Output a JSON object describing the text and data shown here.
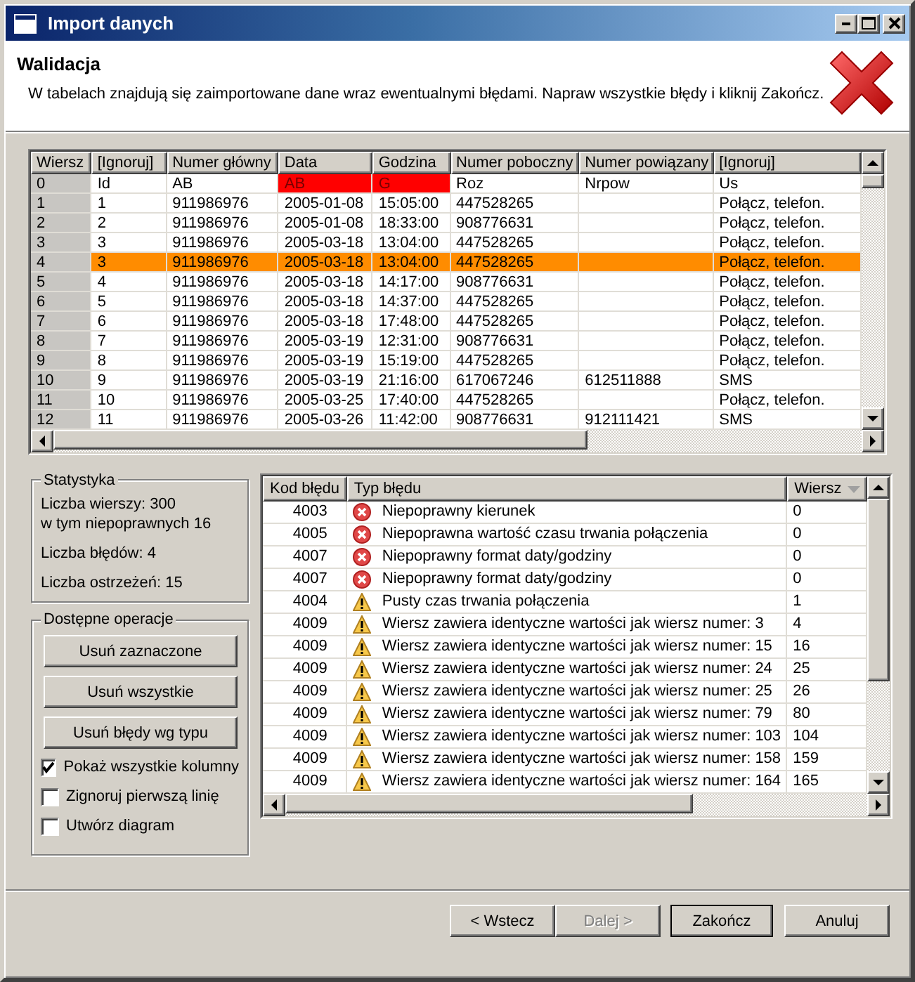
{
  "window": {
    "title": "Import danych"
  },
  "header": {
    "title": "Walidacja",
    "description": "W tabelach znajdują się zaimportowane dane wraz ewentualnymi błędami. Napraw wszystkie błędy i kliknij Zakończ."
  },
  "data_table": {
    "columns": [
      "Wiersz",
      "[Ignoruj]",
      "Numer główny",
      "Data",
      "Godzina",
      "Numer poboczny",
      "Numer powiązany",
      "[Ignoruj]"
    ],
    "rows": [
      {
        "selected": false,
        "cells": [
          {
            "text": "0",
            "error": false
          },
          {
            "text": "Id",
            "error": false
          },
          {
            "text": "AB",
            "error": false
          },
          {
            "text": "AB",
            "error": true
          },
          {
            "text": "G",
            "error": true
          },
          {
            "text": "Roz",
            "error": false
          },
          {
            "text": "Nrpow",
            "error": false
          },
          {
            "text": "Us",
            "error": false
          }
        ]
      },
      {
        "selected": false,
        "cells": [
          {
            "text": "1",
            "error": false
          },
          {
            "text": "1",
            "error": false
          },
          {
            "text": "911986976",
            "error": false
          },
          {
            "text": "2005-01-08",
            "error": false
          },
          {
            "text": "15:05:00",
            "error": false
          },
          {
            "text": "447528265",
            "error": false
          },
          {
            "error": false
          },
          {
            "text": "Połącz, telefon.",
            "error": false
          }
        ]
      },
      {
        "selected": false,
        "cells": [
          {
            "text": "2",
            "error": false
          },
          {
            "text": "2",
            "error": false
          },
          {
            "text": "911986976",
            "error": false
          },
          {
            "text": "2005-01-08",
            "error": false
          },
          {
            "text": "18:33:00",
            "error": false
          },
          {
            "text": "908776631",
            "error": false
          },
          {
            "error": false
          },
          {
            "text": "Połącz, telefon.",
            "error": false
          }
        ]
      },
      {
        "selected": false,
        "cells": [
          {
            "text": "3",
            "error": false
          },
          {
            "text": "3",
            "error": false
          },
          {
            "text": "911986976",
            "error": false
          },
          {
            "text": "2005-03-18",
            "error": false
          },
          {
            "text": "13:04:00",
            "error": false
          },
          {
            "text": "447528265",
            "error": false
          },
          {
            "error": false
          },
          {
            "text": "Połącz, telefon.",
            "error": false
          }
        ]
      },
      {
        "selected": true,
        "cells": [
          {
            "text": "4",
            "error": false
          },
          {
            "text": "3",
            "error": false
          },
          {
            "text": "911986976",
            "error": false
          },
          {
            "text": "2005-03-18",
            "error": false
          },
          {
            "text": "13:04:00",
            "error": false
          },
          {
            "text": "447528265",
            "error": false
          },
          {
            "error": false
          },
          {
            "text": "Połącz, telefon.",
            "error": false
          }
        ]
      },
      {
        "selected": false,
        "cells": [
          {
            "text": "5",
            "error": false
          },
          {
            "text": "4",
            "error": false
          },
          {
            "text": "911986976",
            "error": false
          },
          {
            "text": "2005-03-18",
            "error": false
          },
          {
            "text": "14:17:00",
            "error": false
          },
          {
            "text": "908776631",
            "error": false
          },
          {
            "error": false
          },
          {
            "text": "Połącz, telefon.",
            "error": false
          }
        ]
      },
      {
        "selected": false,
        "cells": [
          {
            "text": "6",
            "error": false
          },
          {
            "text": "5",
            "error": false
          },
          {
            "text": "911986976",
            "error": false
          },
          {
            "text": "2005-03-18",
            "error": false
          },
          {
            "text": "14:37:00",
            "error": false
          },
          {
            "text": "447528265",
            "error": false
          },
          {
            "error": false
          },
          {
            "text": "Połącz, telefon.",
            "error": false
          }
        ]
      },
      {
        "selected": false,
        "cells": [
          {
            "text": "7",
            "error": false
          },
          {
            "text": "6",
            "error": false
          },
          {
            "text": "911986976",
            "error": false
          },
          {
            "text": "2005-03-18",
            "error": false
          },
          {
            "text": "17:48:00",
            "error": false
          },
          {
            "text": "447528265",
            "error": false
          },
          {
            "error": false
          },
          {
            "text": "Połącz, telefon.",
            "error": false
          }
        ]
      },
      {
        "selected": false,
        "cells": [
          {
            "text": "8",
            "error": false
          },
          {
            "text": "7",
            "error": false
          },
          {
            "text": "911986976",
            "error": false
          },
          {
            "text": "2005-03-19",
            "error": false
          },
          {
            "text": "12:31:00",
            "error": false
          },
          {
            "text": "908776631",
            "error": false
          },
          {
            "error": false
          },
          {
            "text": "Połącz, telefon.",
            "error": false
          }
        ]
      },
      {
        "selected": false,
        "cells": [
          {
            "text": "9",
            "error": false
          },
          {
            "text": "8",
            "error": false
          },
          {
            "text": "911986976",
            "error": false
          },
          {
            "text": "2005-03-19",
            "error": false
          },
          {
            "text": "15:19:00",
            "error": false
          },
          {
            "text": "447528265",
            "error": false
          },
          {
            "error": false
          },
          {
            "text": "Połącz, telefon.",
            "error": false
          }
        ]
      },
      {
        "selected": false,
        "cells": [
          {
            "text": "10",
            "error": false
          },
          {
            "text": "9",
            "error": false
          },
          {
            "text": "911986976",
            "error": false
          },
          {
            "text": "2005-03-19",
            "error": false
          },
          {
            "text": "21:16:00",
            "error": false
          },
          {
            "text": "617067246",
            "error": false
          },
          {
            "text": "612511888",
            "error": false
          },
          {
            "text": "SMS",
            "error": false
          }
        ]
      },
      {
        "selected": false,
        "cells": [
          {
            "text": "11",
            "error": false
          },
          {
            "text": "10",
            "error": false
          },
          {
            "text": "911986976",
            "error": false
          },
          {
            "text": "2005-03-25",
            "error": false
          },
          {
            "text": "17:40:00",
            "error": false
          },
          {
            "text": "447528265",
            "error": false
          },
          {
            "error": false
          },
          {
            "text": "Połącz, telefon.",
            "error": false
          }
        ]
      },
      {
        "selected": false,
        "cells": [
          {
            "text": "12",
            "error": false
          },
          {
            "text": "11",
            "error": false
          },
          {
            "text": "911986976",
            "error": false
          },
          {
            "text": "2005-03-26",
            "error": false
          },
          {
            "text": "11:42:00",
            "error": false
          },
          {
            "text": "908776631",
            "error": false
          },
          {
            "text": "912111421",
            "error": false
          },
          {
            "text": "SMS",
            "error": false
          }
        ]
      }
    ]
  },
  "statistics": {
    "title": "Statystyka",
    "lines": [
      "Liczba wierszy: 300",
      "w tym niepoprawnych 16",
      "Liczba błędów: 4",
      "Liczba ostrzeżeń: 15"
    ]
  },
  "operations": {
    "title": "Dostępne operacje",
    "buttons": [
      "Usuń zaznaczone",
      "Usuń wszystkie",
      "Usuń błędy wg typu"
    ],
    "options": [
      {
        "label": "Pokaż wszystkie kolumny",
        "checked": true
      },
      {
        "label": "Zignoruj pierwszą linię",
        "checked": false
      },
      {
        "label": "Utwórz diagram",
        "checked": false
      }
    ]
  },
  "error_table": {
    "columns": [
      "Kod błędu",
      "Typ błędu",
      "Wiersz"
    ],
    "rows": [
      {
        "code": "4003",
        "kind": "error",
        "message": "Niepoprawny kierunek",
        "row": "0"
      },
      {
        "code": "4005",
        "kind": "error",
        "message": "Niepoprawna wartość czasu trwania połączenia",
        "row": "0"
      },
      {
        "code": "4007",
        "kind": "error",
        "message": "Niepoprawny format daty/godziny",
        "row": "0"
      },
      {
        "code": "4007",
        "kind": "error",
        "message": "Niepoprawny format daty/godziny",
        "row": "0"
      },
      {
        "code": "4004",
        "kind": "warning",
        "message": "Pusty czas trwania połączenia",
        "row": "1"
      },
      {
        "code": "4009",
        "kind": "warning",
        "message": "Wiersz zawiera identyczne wartości jak wiersz numer: 3",
        "row": "4"
      },
      {
        "code": "4009",
        "kind": "warning",
        "message": "Wiersz zawiera identyczne wartości jak wiersz numer: 15",
        "row": "16"
      },
      {
        "code": "4009",
        "kind": "warning",
        "message": "Wiersz zawiera identyczne wartości jak wiersz numer: 24",
        "row": "25"
      },
      {
        "code": "4009",
        "kind": "warning",
        "message": "Wiersz zawiera identyczne wartości jak wiersz numer: 25",
        "row": "26"
      },
      {
        "code": "4009",
        "kind": "warning",
        "message": "Wiersz zawiera identyczne wartości jak wiersz numer: 79",
        "row": "80"
      },
      {
        "code": "4009",
        "kind": "warning",
        "message": "Wiersz zawiera identyczne wartości jak wiersz numer: 103",
        "row": "104"
      },
      {
        "code": "4009",
        "kind": "warning",
        "message": "Wiersz zawiera identyczne wartości jak wiersz numer: 158",
        "row": "159"
      },
      {
        "code": "4009",
        "kind": "warning",
        "message": "Wiersz zawiera identyczne wartości jak wiersz numer: 164",
        "row": "165"
      }
    ]
  },
  "wizard_buttons": [
    {
      "label": "< Wstecz",
      "disabled": false,
      "default": false
    },
    {
      "label": "Dalej >",
      "disabled": true,
      "default": false
    },
    {
      "label": "Zakończ",
      "disabled": false,
      "default": true
    },
    {
      "label": "Anuluj",
      "disabled": false,
      "default": false
    }
  ]
}
